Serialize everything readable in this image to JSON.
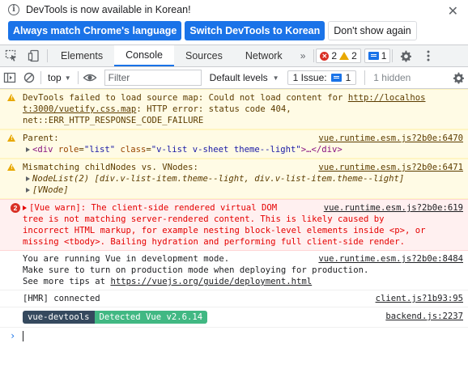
{
  "infobar": {
    "message": "DevTools is now available in Korean!",
    "buttons": [
      "Always match Chrome's language",
      "Switch DevTools to Korean",
      "Don't show again"
    ],
    "close": "✕"
  },
  "tabs": {
    "items": [
      "Elements",
      "Console",
      "Sources",
      "Network"
    ],
    "active": "Console",
    "more": "»",
    "errors": "2",
    "warnings": "2",
    "messages": "1"
  },
  "toolbar": {
    "context": "top",
    "filter_placeholder": "Filter",
    "levels": "Default levels",
    "issues_label": "1 Issue:",
    "issues_count": "1",
    "hidden": "1 hidden"
  },
  "messages": {
    "m1": {
      "line1": "DevTools failed to load source map: Could not load content for ",
      "link": "http://localhost:3000/vuetify.css.map",
      "link_a": "http://localhos",
      "link_b": "t:3000/vuetify.css.map",
      "line2": ": HTTP error: status code 404,",
      "line3": "net::ERR_HTTP_RESPONSE_CODE_FAILURE"
    },
    "m2": {
      "text": "Parent:",
      "src": "vue.runtime.esm.js?2b0e:6470",
      "tag_open": "<div",
      "attr1": "role",
      "val1": "\"list\"",
      "attr2": "class",
      "val2": "\"v-list v-sheet theme--light\"",
      "tag_close": ">…</div>"
    },
    "m3": {
      "text": "Mismatching childNodes vs. VNodes:",
      "src": "vue.runtime.esm.js?2b0e:6471",
      "line2": "NodeList(2) [div.v-list-item.theme--light, div.v-list-item.theme--light]",
      "line3": "[VNode]"
    },
    "m4": {
      "count": "2",
      "text1": "[Vue warn]: The client-side rendered virtual DOM",
      "src": "vue.runtime.esm.js?2b0e:619",
      "text2": "tree is not matching server-rendered content. This is likely caused by",
      "text3": "incorrect HTML markup, for example nesting block-level elements inside <p>, or",
      "text4": "missing <tbody>. Bailing hydration and performing full client-side render."
    },
    "m5": {
      "line1": "You are running Vue in development mode.",
      "src": "vue.runtime.esm.js?2b0e:8484",
      "line2": "Make sure to turn on production mode when deploying for production.",
      "line3": "See more tips at ",
      "link": "https://vuejs.org/guide/deployment.html"
    },
    "m6": {
      "text": "[HMR] connected",
      "src": "client.js?1b93:95"
    },
    "m7": {
      "badge1": "vue-devtools",
      "badge2": "Detected Vue v2.6.14",
      "src": "backend.js:2237"
    }
  },
  "colors": {
    "accent": "#1a73e8",
    "error": "#d93025",
    "warning": "#e8a800",
    "warn_bg": "#fffbe5",
    "error_bg": "#fff0f0"
  }
}
